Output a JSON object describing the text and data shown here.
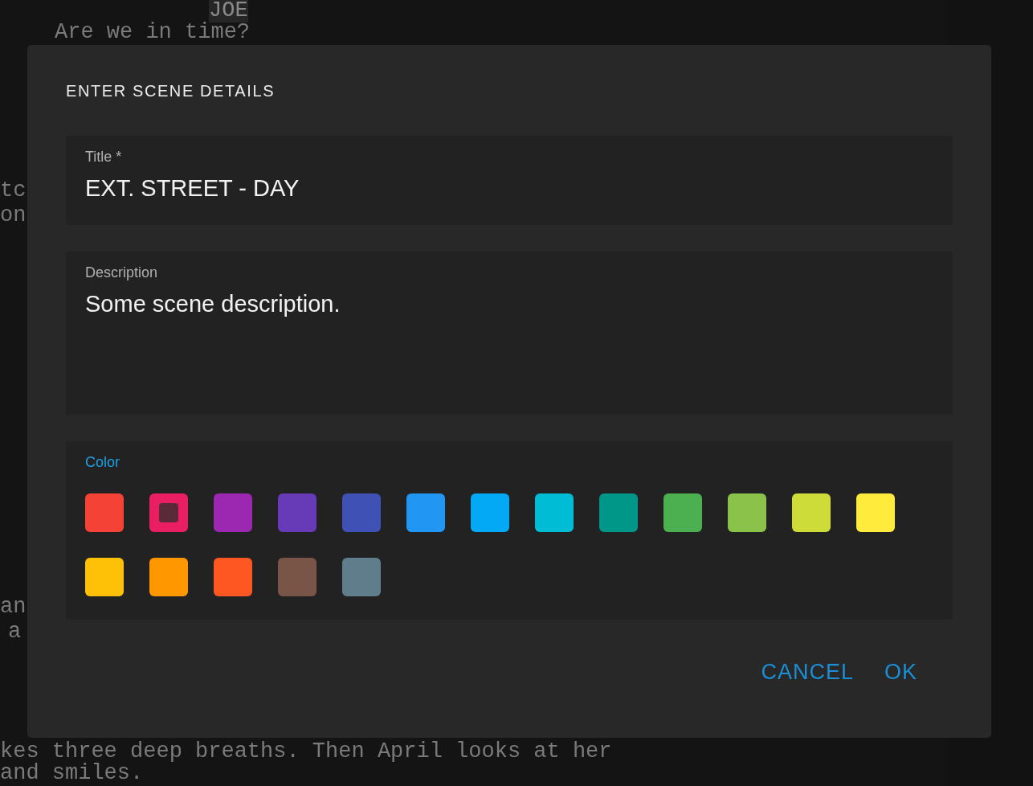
{
  "script_lines": [
    {
      "text": "JOE",
      "highlighted": true
    },
    {
      "text": "Are we in time?",
      "highlighted": false
    },
    {
      "text": "tc",
      "highlighted": false
    },
    {
      "text": "on",
      "highlighted": false
    },
    {
      "text": "an",
      "highlighted": false
    },
    {
      "text": "a",
      "highlighted": false
    },
    {
      "text": "kes three deep breaths. Then April looks at her",
      "highlighted": false
    },
    {
      "text": "and smiles.",
      "highlighted": false
    }
  ],
  "dialog": {
    "title": "ENTER SCENE DETAILS",
    "title_field": {
      "label": "Title *",
      "value": "EXT. STREET - DAY"
    },
    "description_field": {
      "label": "Description",
      "value": "Some scene description."
    },
    "color_field": {
      "label": "Color",
      "swatches": [
        {
          "color": "#f44336",
          "selected": false
        },
        {
          "color": "#e91e63",
          "selected": true
        },
        {
          "color": "#9c27b0",
          "selected": false
        },
        {
          "color": "#673ab7",
          "selected": false
        },
        {
          "color": "#3f51b5",
          "selected": false
        },
        {
          "color": "#2196f3",
          "selected": false
        },
        {
          "color": "#03a9f4",
          "selected": false
        },
        {
          "color": "#00bcd4",
          "selected": false
        },
        {
          "color": "#009688",
          "selected": false
        },
        {
          "color": "#4caf50",
          "selected": false
        },
        {
          "color": "#8bc34a",
          "selected": false
        },
        {
          "color": "#cddc39",
          "selected": false
        },
        {
          "color": "#ffeb3b",
          "selected": false
        },
        {
          "color": "#ffc107",
          "selected": false
        },
        {
          "color": "#ff9800",
          "selected": false
        },
        {
          "color": "#ff5722",
          "selected": false
        },
        {
          "color": "#795548",
          "selected": false
        },
        {
          "color": "#607d8b",
          "selected": false
        }
      ]
    },
    "buttons": [
      "CANCEL",
      "OK"
    ]
  }
}
